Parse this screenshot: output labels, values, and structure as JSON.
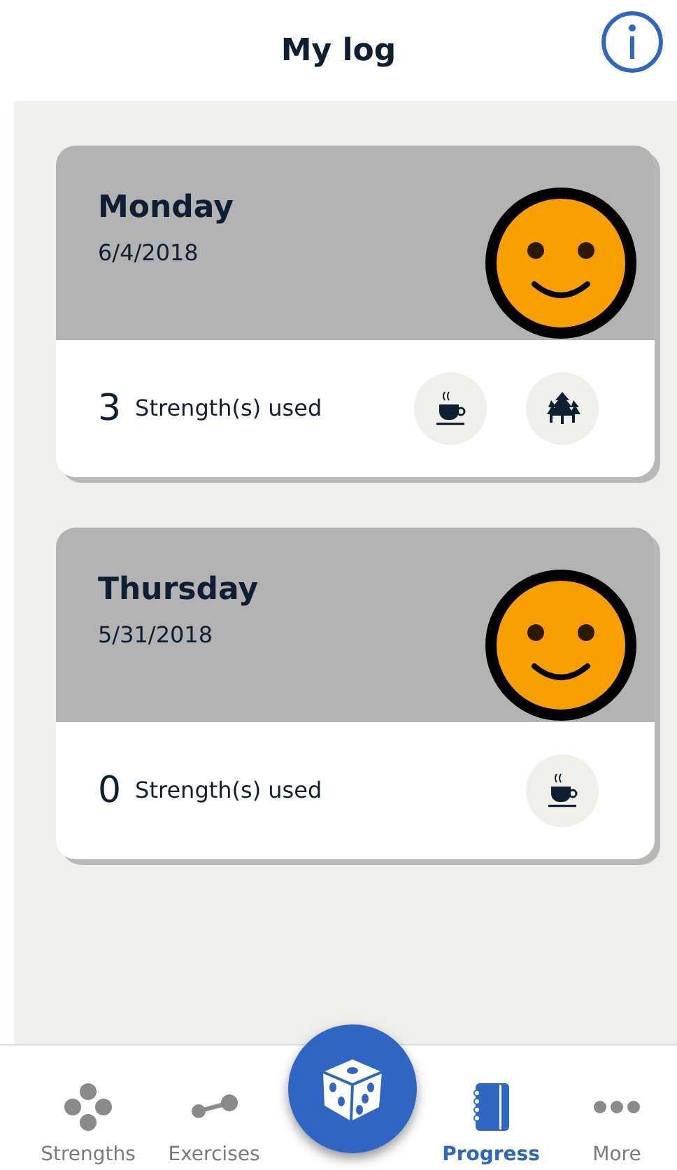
{
  "header": {
    "title": "My log"
  },
  "entries": [
    {
      "day": "Monday",
      "date": "6/4/2018",
      "face": {
        "kind": "happy"
      },
      "count": "3",
      "count_label": "Strength(s) used",
      "strengths": [
        {
          "kind": "cup"
        },
        {
          "kind": "trees"
        }
      ]
    },
    {
      "day": "Thursday",
      "date": "5/31/2018",
      "face": {
        "kind": "happy"
      },
      "count": "0",
      "count_label": "Strength(s) used",
      "strengths": [
        {
          "kind": "cup"
        }
      ]
    }
  ],
  "tabs": [
    {
      "kind": "dots",
      "label": "Strengths",
      "selected": false
    },
    {
      "kind": "link",
      "label": "Exercises",
      "selected": false
    },
    {
      "kind": "notebook",
      "label": "Progress",
      "selected": true
    },
    {
      "kind": "more",
      "label": "More",
      "selected": false
    }
  ]
}
